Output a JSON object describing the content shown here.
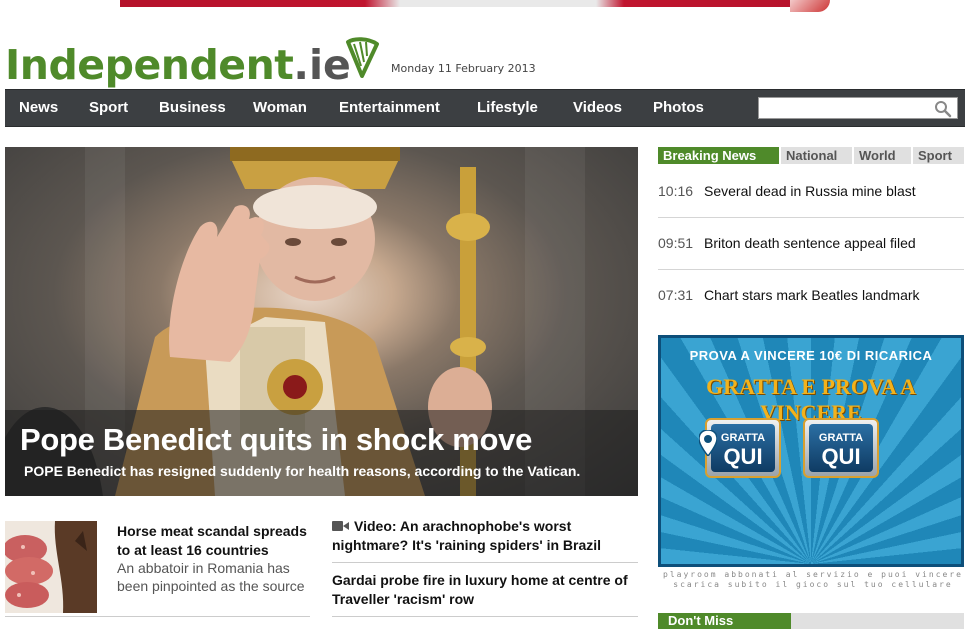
{
  "brand": {
    "name": "Independent",
    "suffix": ".ie",
    "date": "Monday 11 February 2013",
    "accent": "#4f8a2a",
    "nav_bg": "#3c3f42"
  },
  "nav": {
    "items": [
      "News",
      "Sport",
      "Business",
      "Woman",
      "Entertainment",
      "Lifestyle",
      "Videos",
      "Photos"
    ],
    "search_placeholder": ""
  },
  "hero": {
    "title": "Pope Benedict quits in shock move",
    "subtitle": "POPE Benedict has resigned suddenly for health reasons, according to the Vatican."
  },
  "stories_left": [
    {
      "title": "Horse meat scandal spreads to at least 16 countries",
      "summary": "An abbatoir in Romania has been pinpointed as the source"
    }
  ],
  "stories_mid": [
    {
      "title": "Video: An arachnophobe's worst nightmare? It's 'raining spiders' in Brazil",
      "icon": "video-icon"
    },
    {
      "title": "Gardai probe fire in luxury home at centre of Traveller 'racism' row"
    }
  ],
  "breaking": {
    "tabs": [
      "Breaking News",
      "National",
      "World",
      "Sport"
    ],
    "active_tab": "Breaking News",
    "items": [
      {
        "time": "10:16",
        "text": "Several dead in Russia mine blast"
      },
      {
        "time": "09:51",
        "text": "Briton death sentence appeal filed"
      },
      {
        "time": "07:31",
        "text": "Chart stars mark Beatles landmark"
      }
    ]
  },
  "ad": {
    "line1": "PROVA A VINCERE 10€ DI RICARICA",
    "line2": "GRATTA E PROVA A VINCERE",
    "card_label1": "GRATTA",
    "card_label2": "QUI",
    "footer_line1": "playroom abbonati al servizio e puoi vincere",
    "footer_line2": "scarica subito il gioco sul tuo cellulare"
  },
  "dont_miss": {
    "label": "Don't Miss"
  }
}
